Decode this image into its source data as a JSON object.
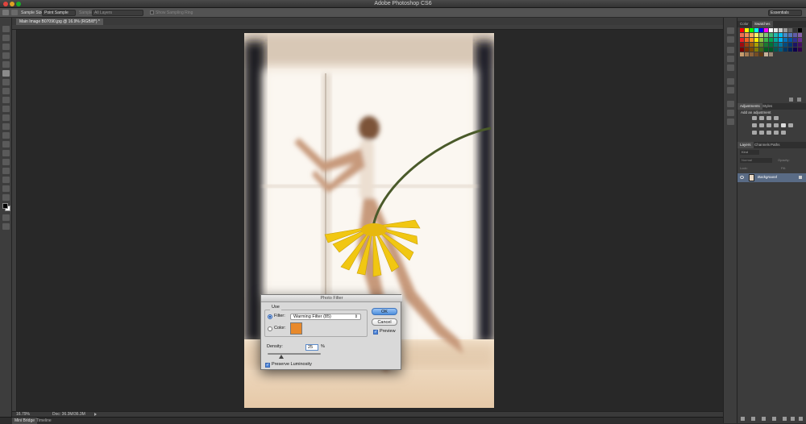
{
  "app": {
    "title": "Adobe Photoshop CS6"
  },
  "options_bar": {
    "sample_size_label": "Sample Size:",
    "sample_size_value": "Point Sample",
    "sample_label": "Sample:",
    "sample_value": "All Layers",
    "show_ring_label": "Show Sampling Ring",
    "workspace": "Essentials"
  },
  "document": {
    "tab_title": "Main Image B07090.jpg @ 16.9% (RGB/8*) *",
    "zoom": "16.79%",
    "doc_size": "Doc: 36.3M/36.3M"
  },
  "bottom_tabs": [
    "Mini Bridge",
    "Timeline"
  ],
  "panels": {
    "color_tabs": [
      "Color",
      "Swatches"
    ],
    "adjustments_tabs": [
      "Adjustments",
      "Styles"
    ],
    "add_adjustment": "Add an adjustment",
    "layers_tabs": [
      "Layers",
      "Channels",
      "Paths"
    ],
    "kind_label": "Kind",
    "blend_mode": "Normal",
    "opacity_label": "Opacity:",
    "lock_label": "Lock:",
    "fill_label": "Fill:",
    "layer_name": "Background"
  },
  "photo_filter": {
    "title": "Photo Filter",
    "use_label": "Use",
    "filter_label": "Filter:",
    "filter_value": "Warming Filter (85)",
    "color_label": "Color:",
    "swatch_color": "#e8892b",
    "density_label": "Density:",
    "density_value": "25",
    "density_unit": "%",
    "density_fraction": 0.25,
    "preserve_label": "Preserve Luminosity",
    "preserve_checked": true,
    "ok_label": "OK",
    "cancel_label": "Cancel",
    "preview_label": "Preview",
    "preview_checked": true
  },
  "colors": {
    "accent": "#4d8fdc",
    "panel_bg": "#3c3c3c",
    "canvas_bg": "#282828"
  }
}
